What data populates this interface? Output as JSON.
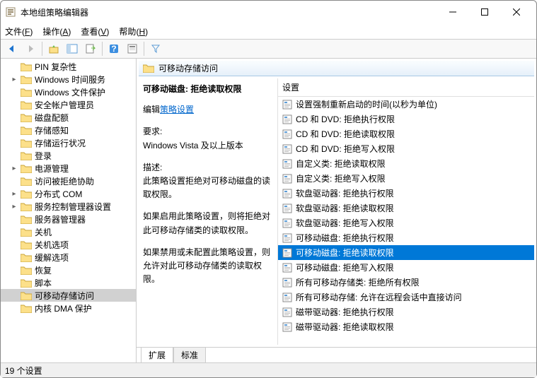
{
  "window": {
    "title": "本地组策略编辑器"
  },
  "menubar": {
    "file": {
      "label": "文件",
      "key": "F"
    },
    "action": {
      "label": "操作",
      "key": "A"
    },
    "view": {
      "label": "查看",
      "key": "V"
    },
    "help": {
      "label": "帮助",
      "key": "H"
    }
  },
  "tree": {
    "items": [
      {
        "label": "PIN 复杂性",
        "expandable": false
      },
      {
        "label": "Windows 时间服务",
        "expandable": true
      },
      {
        "label": "Windows 文件保护",
        "expandable": false
      },
      {
        "label": "安全帐户管理员",
        "expandable": false
      },
      {
        "label": "磁盘配额",
        "expandable": false
      },
      {
        "label": "存储感知",
        "expandable": false
      },
      {
        "label": "存储运行状况",
        "expandable": false
      },
      {
        "label": "登录",
        "expandable": false
      },
      {
        "label": "电源管理",
        "expandable": true
      },
      {
        "label": "访问被拒绝协助",
        "expandable": false
      },
      {
        "label": "分布式 COM",
        "expandable": true
      },
      {
        "label": "服务控制管理器设置",
        "expandable": true
      },
      {
        "label": "服务器管理器",
        "expandable": false
      },
      {
        "label": "关机",
        "expandable": false
      },
      {
        "label": "关机选项",
        "expandable": false
      },
      {
        "label": "缓解选项",
        "expandable": false
      },
      {
        "label": "恢复",
        "expandable": false
      },
      {
        "label": "脚本",
        "expandable": false
      },
      {
        "label": "可移动存储访问",
        "expandable": false,
        "selected": true
      },
      {
        "label": "内核 DMA 保护",
        "expandable": false
      }
    ]
  },
  "right": {
    "header": "可移动存储访问",
    "policy_title": "可移动磁盘: 拒绝读取权限",
    "edit_label": "编辑",
    "edit_link": "策略设置",
    "req_label": "要求:",
    "req_value": "Windows Vista 及以上版本",
    "desc_label": "描述:",
    "desc_value": "此策略设置拒绝对可移动磁盘的读取权限。",
    "desc_enabled": "如果启用此策略设置，则将拒绝对此可移动存储类的读取权限。",
    "desc_disabled": "如果禁用或未配置此策略设置，则允许对此可移动存储类的读取权限。",
    "list_header": "设置",
    "items": [
      "设置强制重新启动的时间(以秒为单位)",
      "CD 和 DVD: 拒绝执行权限",
      "CD 和 DVD: 拒绝读取权限",
      "CD 和 DVD: 拒绝写入权限",
      "自定义类: 拒绝读取权限",
      "自定义类: 拒绝写入权限",
      "软盘驱动器: 拒绝执行权限",
      "软盘驱动器: 拒绝读取权限",
      "软盘驱动器: 拒绝写入权限",
      "可移动磁盘: 拒绝执行权限",
      "可移动磁盘: 拒绝读取权限",
      "可移动磁盘: 拒绝写入权限",
      "所有可移动存储类: 拒绝所有权限",
      "所有可移动存储: 允许在远程会话中直接访问",
      "磁带驱动器: 拒绝执行权限",
      "磁带驱动器: 拒绝读取权限"
    ],
    "selected_index": 10
  },
  "tabs": {
    "extended": "扩展",
    "standard": "标准"
  },
  "statusbar": "19 个设置"
}
